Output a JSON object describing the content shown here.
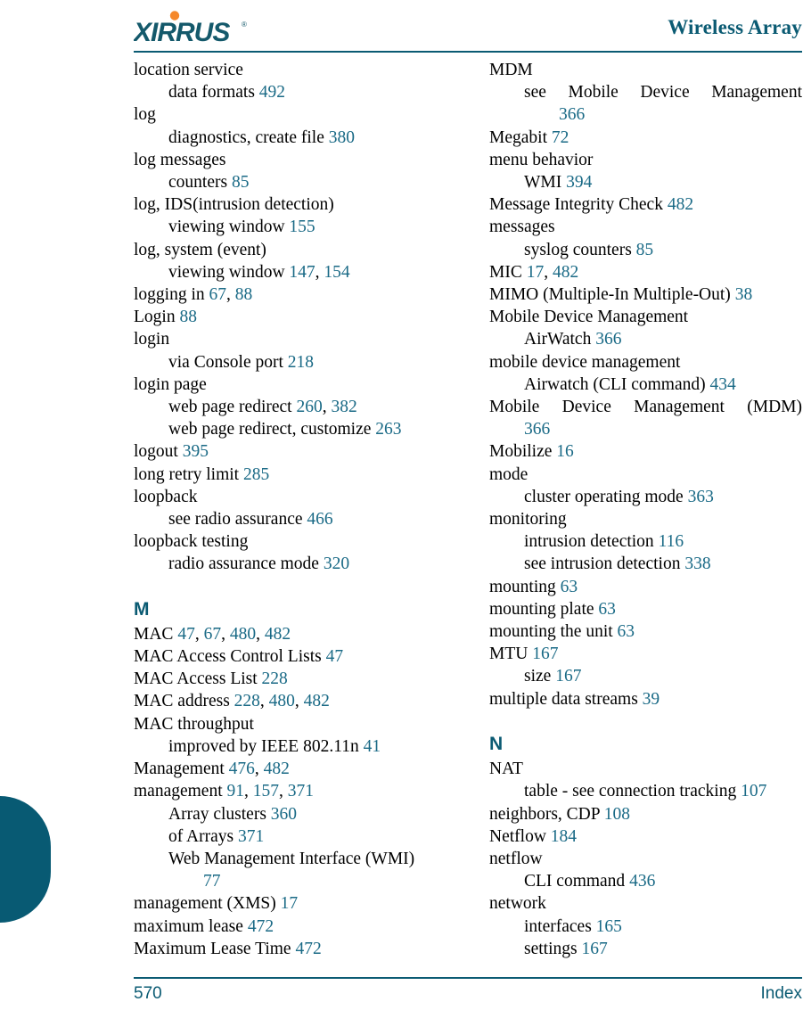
{
  "header": {
    "logo_text": "XIRRUS",
    "logo_trademark": "®",
    "title": "Wireless Array",
    "logo_color": "#14596B",
    "logo_dot_color": "#F5882B",
    "rule_color": "#0B5B73"
  },
  "footer": {
    "page_number": "570",
    "label": "Index",
    "color": "#0B5B73"
  },
  "side_tab": {
    "color": "#085A73"
  },
  "colors": {
    "page_number_link": "#1A6A86",
    "section_letter": "#0B5B73",
    "body_text": "#000000"
  },
  "columns": {
    "left": [
      {
        "type": "entry",
        "level": 1,
        "text": "location service",
        "pages": []
      },
      {
        "type": "entry",
        "level": 2,
        "text": "data formats",
        "pages": [
          "492"
        ]
      },
      {
        "type": "entry",
        "level": 1,
        "text": "log",
        "pages": []
      },
      {
        "type": "entry",
        "level": 2,
        "text": "diagnostics, create file",
        "pages": [
          "380"
        ]
      },
      {
        "type": "entry",
        "level": 1,
        "text": "log messages",
        "pages": []
      },
      {
        "type": "entry",
        "level": 2,
        "text": "counters",
        "pages": [
          "85"
        ]
      },
      {
        "type": "entry",
        "level": 1,
        "text": "log, IDS(intrusion detection)",
        "pages": []
      },
      {
        "type": "entry",
        "level": 2,
        "text": "viewing window",
        "pages": [
          "155"
        ]
      },
      {
        "type": "entry",
        "level": 1,
        "text": "log, system (event)",
        "pages": []
      },
      {
        "type": "entry",
        "level": 2,
        "text": "viewing window",
        "pages": [
          "147",
          "154"
        ]
      },
      {
        "type": "entry",
        "level": 1,
        "text": "logging in",
        "pages": [
          "67",
          "88"
        ]
      },
      {
        "type": "entry",
        "level": 1,
        "text": "Login",
        "pages": [
          "88"
        ]
      },
      {
        "type": "entry",
        "level": 1,
        "text": "login",
        "pages": []
      },
      {
        "type": "entry",
        "level": 2,
        "text": "via Console port",
        "pages": [
          "218"
        ]
      },
      {
        "type": "entry",
        "level": 1,
        "text": "login page",
        "pages": []
      },
      {
        "type": "entry",
        "level": 2,
        "text": "web page redirect",
        "pages": [
          "260",
          "382"
        ]
      },
      {
        "type": "entry",
        "level": 2,
        "text": "web page redirect, customize",
        "pages": [
          "263"
        ]
      },
      {
        "type": "entry",
        "level": 1,
        "text": "logout",
        "pages": [
          "395"
        ]
      },
      {
        "type": "entry",
        "level": 1,
        "text": "long retry limit",
        "pages": [
          "285"
        ]
      },
      {
        "type": "entry",
        "level": 1,
        "text": "loopback",
        "pages": []
      },
      {
        "type": "entry",
        "level": 2,
        "text": "see radio assurance",
        "pages": [
          "466"
        ]
      },
      {
        "type": "entry",
        "level": 1,
        "text": "loopback testing",
        "pages": []
      },
      {
        "type": "entry",
        "level": 2,
        "text": "radio assurance mode",
        "pages": [
          "320"
        ]
      },
      {
        "type": "section",
        "letter": "M"
      },
      {
        "type": "entry",
        "level": 1,
        "text": "MAC",
        "pages": [
          "47",
          "67",
          "480",
          "482"
        ]
      },
      {
        "type": "entry",
        "level": 1,
        "text": "MAC Access Control Lists",
        "pages": [
          "47"
        ]
      },
      {
        "type": "entry",
        "level": 1,
        "text": "MAC Access List",
        "pages": [
          "228"
        ]
      },
      {
        "type": "entry",
        "level": 1,
        "text": "MAC address",
        "pages": [
          "228",
          "480",
          "482"
        ]
      },
      {
        "type": "entry",
        "level": 1,
        "text": "MAC throughput",
        "pages": []
      },
      {
        "type": "entry",
        "level": 2,
        "text": "improved by IEEE 802.11n",
        "pages": [
          "41"
        ]
      },
      {
        "type": "entry",
        "level": 1,
        "text": "Management",
        "pages": [
          "476",
          "482"
        ]
      },
      {
        "type": "entry",
        "level": 1,
        "text": "management",
        "pages": [
          "91",
          "157",
          "371"
        ]
      },
      {
        "type": "entry",
        "level": 2,
        "text": "Array clusters",
        "pages": [
          "360"
        ]
      },
      {
        "type": "entry",
        "level": 2,
        "text": "of Arrays",
        "pages": [
          "371"
        ]
      },
      {
        "type": "entry",
        "level": 2,
        "text": "Web Management Interface (WMI)",
        "pages": []
      },
      {
        "type": "entry",
        "level": 3,
        "text": "",
        "pages": [
          "77"
        ]
      },
      {
        "type": "entry",
        "level": 1,
        "text": "management (XMS)",
        "pages": [
          "17"
        ]
      },
      {
        "type": "entry",
        "level": 1,
        "text": "maximum lease",
        "pages": [
          "472"
        ]
      },
      {
        "type": "entry",
        "level": 1,
        "text": "Maximum Lease Time",
        "pages": [
          "472"
        ]
      }
    ],
    "right": [
      {
        "type": "entry",
        "level": 1,
        "text": "MDM",
        "pages": []
      },
      {
        "type": "entry",
        "level": 2,
        "justify": true,
        "text": "see Mobile Device Management",
        "pages": []
      },
      {
        "type": "entry",
        "level": 3,
        "text": "",
        "pages": [
          "366"
        ]
      },
      {
        "type": "entry",
        "level": 1,
        "text": "Megabit",
        "pages": [
          "72"
        ]
      },
      {
        "type": "entry",
        "level": 1,
        "text": "menu behavior",
        "pages": []
      },
      {
        "type": "entry",
        "level": 2,
        "text": "WMI",
        "pages": [
          "394"
        ]
      },
      {
        "type": "entry",
        "level": 1,
        "text": "Message Integrity Check",
        "pages": [
          "482"
        ]
      },
      {
        "type": "entry",
        "level": 1,
        "text": "messages",
        "pages": []
      },
      {
        "type": "entry",
        "level": 2,
        "text": "syslog counters",
        "pages": [
          "85"
        ]
      },
      {
        "type": "entry",
        "level": 1,
        "text": "MIC",
        "pages": [
          "17",
          "482"
        ]
      },
      {
        "type": "entry",
        "level": 1,
        "text": "MIMO (Multiple-In Multiple-Out)",
        "pages": [
          "38"
        ]
      },
      {
        "type": "entry",
        "level": 1,
        "text": "Mobile Device Management",
        "pages": []
      },
      {
        "type": "entry",
        "level": 2,
        "text": "AirWatch",
        "pages": [
          "366"
        ]
      },
      {
        "type": "entry",
        "level": 1,
        "text": "mobile device management",
        "pages": []
      },
      {
        "type": "entry",
        "level": 2,
        "text": "Airwatch (CLI command)",
        "pages": [
          "434"
        ]
      },
      {
        "type": "entry",
        "level": 1,
        "justify": true,
        "text": "Mobile Device Management (MDM)",
        "pages": []
      },
      {
        "type": "entry",
        "level": 2,
        "text": "",
        "pages": [
          "366"
        ]
      },
      {
        "type": "entry",
        "level": 1,
        "text": "Mobilize",
        "pages": [
          "16"
        ]
      },
      {
        "type": "entry",
        "level": 1,
        "text": "mode",
        "pages": []
      },
      {
        "type": "entry",
        "level": 2,
        "text": "cluster operating mode",
        "pages": [
          "363"
        ]
      },
      {
        "type": "entry",
        "level": 1,
        "text": "monitoring",
        "pages": []
      },
      {
        "type": "entry",
        "level": 2,
        "text": "intrusion detection",
        "pages": [
          "116"
        ]
      },
      {
        "type": "entry",
        "level": 2,
        "text": "see intrusion detection",
        "pages": [
          "338"
        ]
      },
      {
        "type": "entry",
        "level": 1,
        "text": "mounting",
        "pages": [
          "63"
        ]
      },
      {
        "type": "entry",
        "level": 1,
        "text": "mounting plate",
        "pages": [
          "63"
        ]
      },
      {
        "type": "entry",
        "level": 1,
        "text": "mounting the unit",
        "pages": [
          "63"
        ]
      },
      {
        "type": "entry",
        "level": 1,
        "text": "MTU",
        "pages": [
          "167"
        ]
      },
      {
        "type": "entry",
        "level": 2,
        "text": "size",
        "pages": [
          "167"
        ]
      },
      {
        "type": "entry",
        "level": 1,
        "text": "multiple data streams",
        "pages": [
          "39"
        ]
      },
      {
        "type": "section",
        "letter": "N"
      },
      {
        "type": "entry",
        "level": 1,
        "text": "NAT",
        "pages": []
      },
      {
        "type": "entry",
        "level": 2,
        "text": "table - see connection tracking",
        "pages": [
          "107"
        ]
      },
      {
        "type": "entry",
        "level": 1,
        "text": "neighbors, CDP",
        "pages": [
          "108"
        ]
      },
      {
        "type": "entry",
        "level": 1,
        "text": "Netflow",
        "pages": [
          "184"
        ]
      },
      {
        "type": "entry",
        "level": 1,
        "text": "netflow",
        "pages": []
      },
      {
        "type": "entry",
        "level": 2,
        "text": "CLI command",
        "pages": [
          "436"
        ]
      },
      {
        "type": "entry",
        "level": 1,
        "text": "network",
        "pages": []
      },
      {
        "type": "entry",
        "level": 2,
        "text": "interfaces",
        "pages": [
          "165"
        ]
      },
      {
        "type": "entry",
        "level": 2,
        "text": "settings",
        "pages": [
          "167"
        ]
      }
    ]
  }
}
